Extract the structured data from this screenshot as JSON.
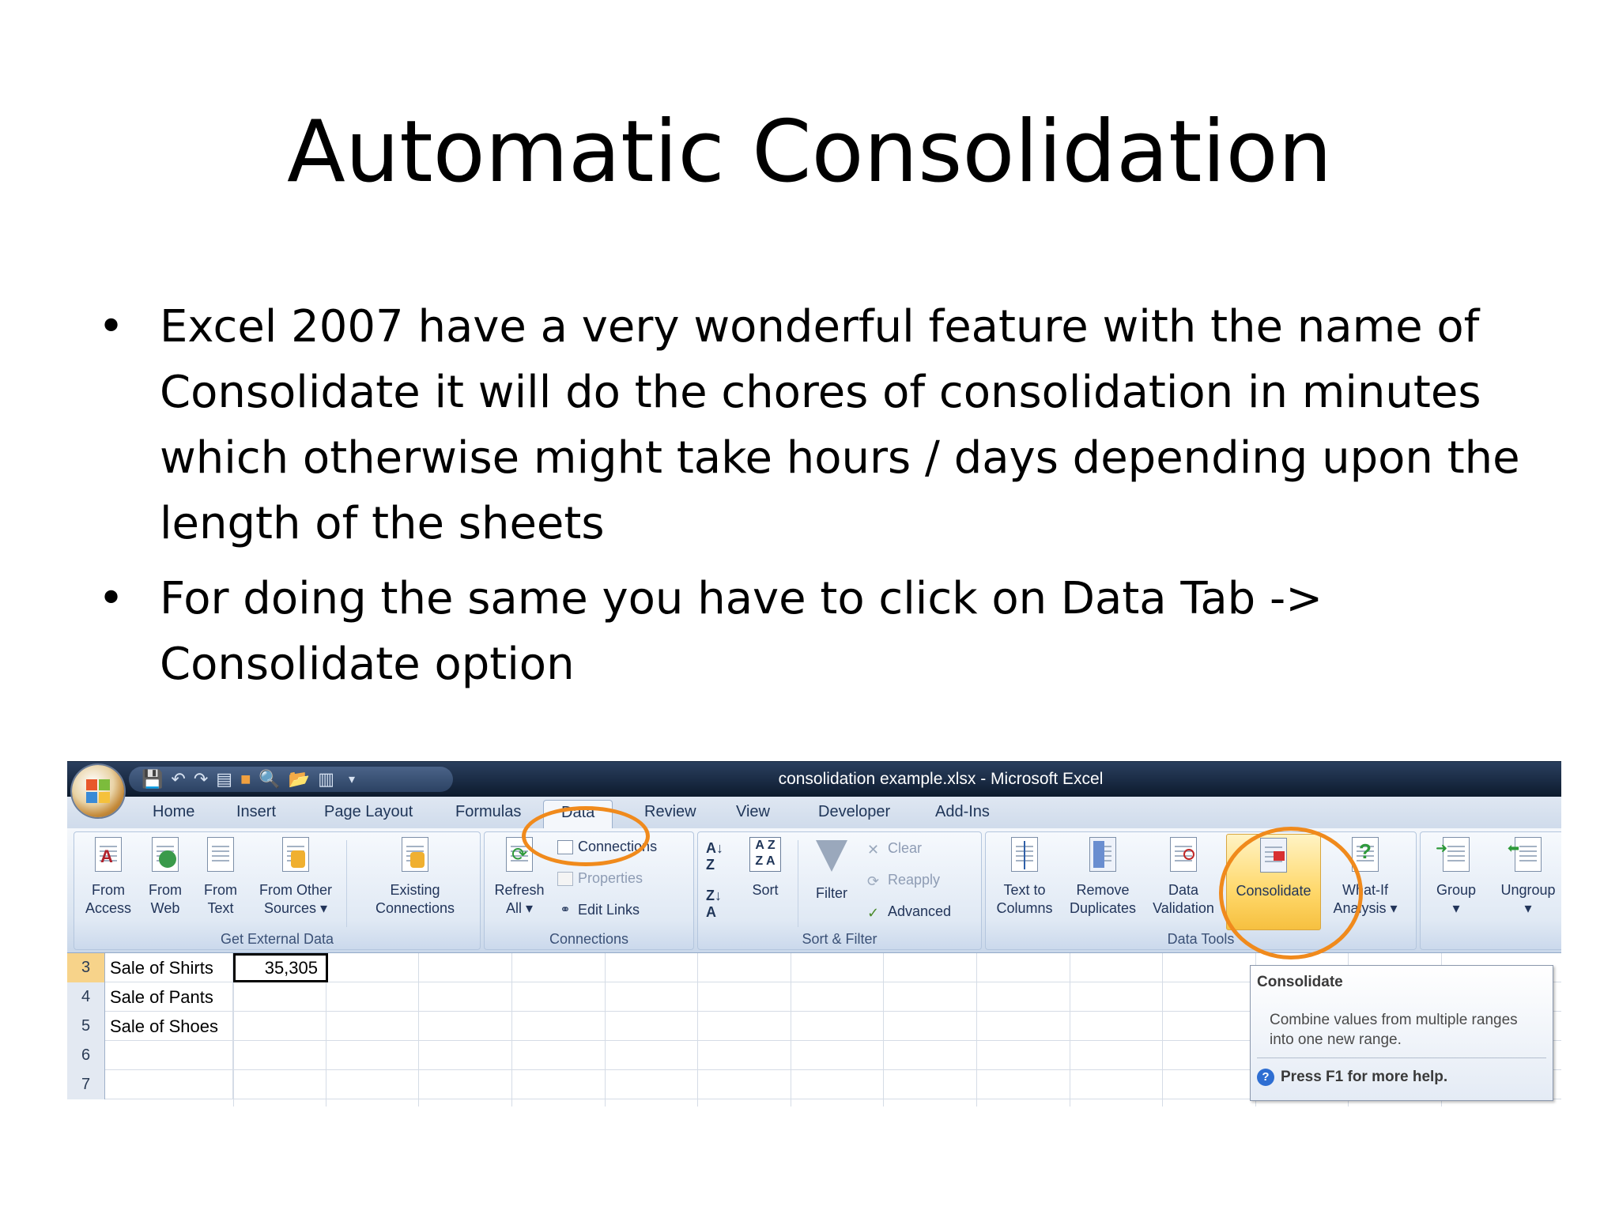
{
  "slide": {
    "title": "Automatic Consolidation",
    "bullets": [
      "Excel 2007 have a very wonderful feature with the name of Consolidate it will do the chores of consolidation in minutes which otherwise might take hours / days depending upon the length of the sheets",
      "For doing the same  you have to click on Data Tab -> Consolidate option"
    ],
    "bullet_glyph": "•"
  },
  "excel": {
    "window_title": "consolidation example.xlsx - Microsoft Excel",
    "tabs": [
      "Home",
      "Insert",
      "Page Layout",
      "Formulas",
      "Data",
      "Review",
      "View",
      "Developer",
      "Add-Ins"
    ],
    "active_tab": "Data",
    "groups": {
      "get_external": {
        "label": "Get External Data",
        "buttons": [
          {
            "line1": "From",
            "line2": "Access"
          },
          {
            "line1": "From",
            "line2": "Web"
          },
          {
            "line1": "From",
            "line2": "Text"
          },
          {
            "line1": "From Other",
            "line2": "Sources ▾"
          },
          {
            "line1": "Existing",
            "line2": "Connections"
          }
        ]
      },
      "connections": {
        "label": "Connections",
        "refresh": {
          "line1": "Refresh",
          "line2": "All ▾"
        },
        "items": [
          "Connections",
          "Properties",
          "Edit Links"
        ]
      },
      "sort_filter": {
        "label": "Sort & Filter",
        "sort": "Sort",
        "filter": "Filter",
        "items": [
          "Clear",
          "Reapply",
          "Advanced"
        ]
      },
      "data_tools": {
        "label": "Data Tools",
        "buttons": [
          {
            "line1": "Text to",
            "line2": "Columns"
          },
          {
            "line1": "Remove",
            "line2": "Duplicates"
          },
          {
            "line1": "Data",
            "line2": "Validation"
          },
          {
            "line1": "Consolidate",
            "line2": ""
          },
          {
            "line1": "What-If",
            "line2": "Analysis ▾"
          }
        ]
      },
      "outline": {
        "buttons": [
          {
            "line1": "Group",
            "line2": "▾"
          },
          {
            "line1": "Ungroup",
            "line2": "▾"
          }
        ]
      }
    },
    "rows": [
      {
        "num": "3",
        "label": "Sale of Shirts",
        "value": "35,305"
      },
      {
        "num": "4",
        "label": "Sale of Pants",
        "value": ""
      },
      {
        "num": "5",
        "label": "Sale of Shoes",
        "value": ""
      },
      {
        "num": "6",
        "label": "",
        "value": ""
      },
      {
        "num": "7",
        "label": "",
        "value": ""
      }
    ],
    "tooltip": {
      "title": "Consolidate",
      "body": "Combine values from multiple ranges into one new range.",
      "help": "Press F1 for more help."
    }
  },
  "colors": {
    "highlight": "#f08a1c",
    "titlebar": "#1a2b44",
    "ribbon": "#dbe5f1"
  }
}
